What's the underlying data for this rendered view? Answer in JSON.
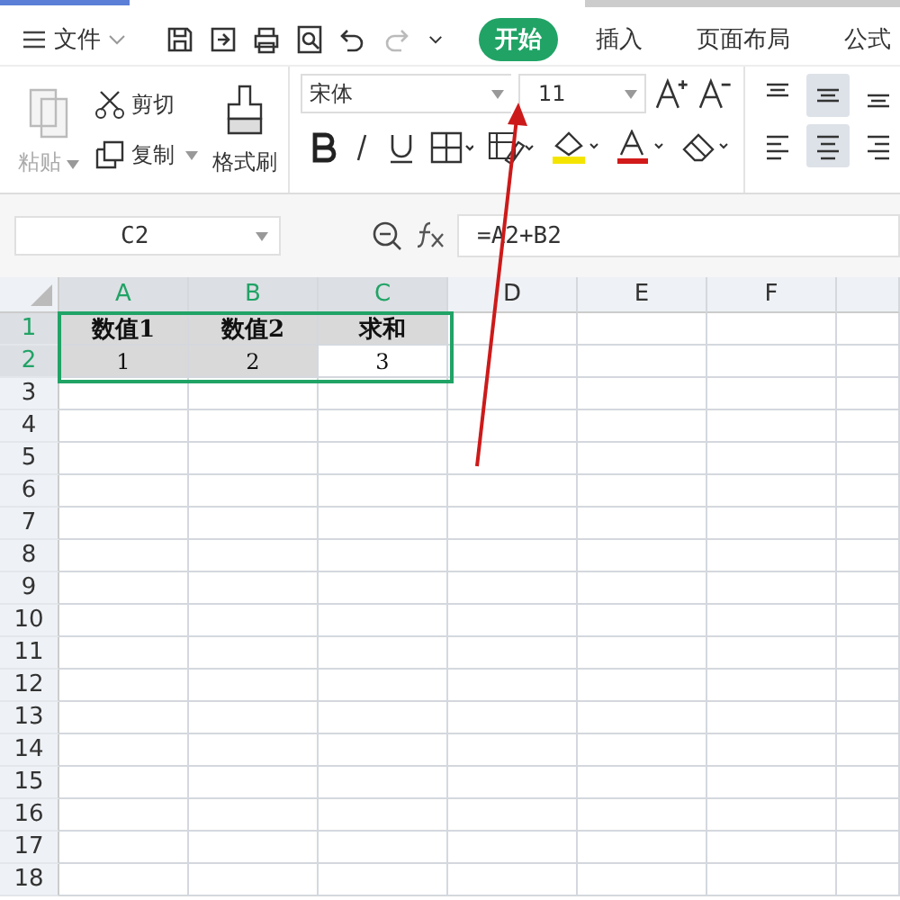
{
  "file_menu": {
    "label": "文件"
  },
  "quick_tools": [
    {
      "kind": "save",
      "disabled": false
    },
    {
      "kind": "export",
      "disabled": false
    },
    {
      "kind": "print",
      "disabled": false
    },
    {
      "kind": "preview",
      "disabled": false
    },
    {
      "kind": "undo",
      "disabled": false
    },
    {
      "kind": "redo",
      "disabled": true
    },
    {
      "kind": "more",
      "disabled": false
    }
  ],
  "tabs": [
    {
      "label": "开始",
      "selected": true
    },
    {
      "label": "插入",
      "selected": false
    },
    {
      "label": "页面布局",
      "selected": false
    },
    {
      "label": "公式",
      "selected": false
    }
  ],
  "ribbon": {
    "paste": {
      "label": "粘贴",
      "disabled": true
    },
    "cut": {
      "label": "剪切"
    },
    "copy": {
      "label": "复制"
    },
    "format_painter": {
      "label": "格式刷"
    },
    "font": {
      "value": "宋体"
    },
    "font_size": {
      "value": "11"
    },
    "align_buttons": [
      {
        "kind": "top",
        "selected": false
      },
      {
        "kind": "middle",
        "selected": true
      },
      {
        "kind": "bottom",
        "selected": false
      },
      {
        "kind": "left",
        "selected": false
      },
      {
        "kind": "center",
        "selected": true
      },
      {
        "kind": "right",
        "selected": false
      }
    ]
  },
  "formula_bar": {
    "name_box": "C2",
    "formula": "=A2+B2"
  },
  "grid": {
    "columns": [
      {
        "label": "A",
        "selected": true
      },
      {
        "label": "B",
        "selected": true
      },
      {
        "label": "C",
        "selected": true
      },
      {
        "label": "D",
        "selected": false
      },
      {
        "label": "E",
        "selected": false
      },
      {
        "label": "F",
        "selected": false
      }
    ],
    "rows": [
      {
        "label": "1",
        "selected": true,
        "cells": [
          {
            "text": "数值1",
            "bold": true,
            "shaded": true
          },
          {
            "text": "数值2",
            "bold": true,
            "shaded": true
          },
          {
            "text": "求和",
            "bold": true,
            "shaded": true
          }
        ]
      },
      {
        "label": "2",
        "selected": true,
        "cells": [
          {
            "text": "1",
            "bold": false,
            "shaded": true
          },
          {
            "text": "2",
            "bold": false,
            "shaded": true
          },
          {
            "text": "3",
            "bold": false,
            "shaded": false
          }
        ]
      },
      {
        "label": "3",
        "selected": false,
        "cells": []
      },
      {
        "label": "4",
        "selected": false,
        "cells": []
      },
      {
        "label": "5",
        "selected": false,
        "cells": []
      },
      {
        "label": "6",
        "selected": false,
        "cells": []
      },
      {
        "label": "7",
        "selected": false,
        "cells": []
      },
      {
        "label": "8",
        "selected": false,
        "cells": []
      },
      {
        "label": "9",
        "selected": false,
        "cells": []
      },
      {
        "label": "10",
        "selected": false,
        "cells": []
      },
      {
        "label": "11",
        "selected": false,
        "cells": []
      },
      {
        "label": "12",
        "selected": false,
        "cells": []
      },
      {
        "label": "13",
        "selected": false,
        "cells": []
      },
      {
        "label": "14",
        "selected": false,
        "cells": []
      },
      {
        "label": "15",
        "selected": false,
        "cells": []
      },
      {
        "label": "16",
        "selected": false,
        "cells": []
      },
      {
        "label": "17",
        "selected": false,
        "cells": []
      },
      {
        "label": "18",
        "selected": false,
        "cells": []
      }
    ]
  }
}
